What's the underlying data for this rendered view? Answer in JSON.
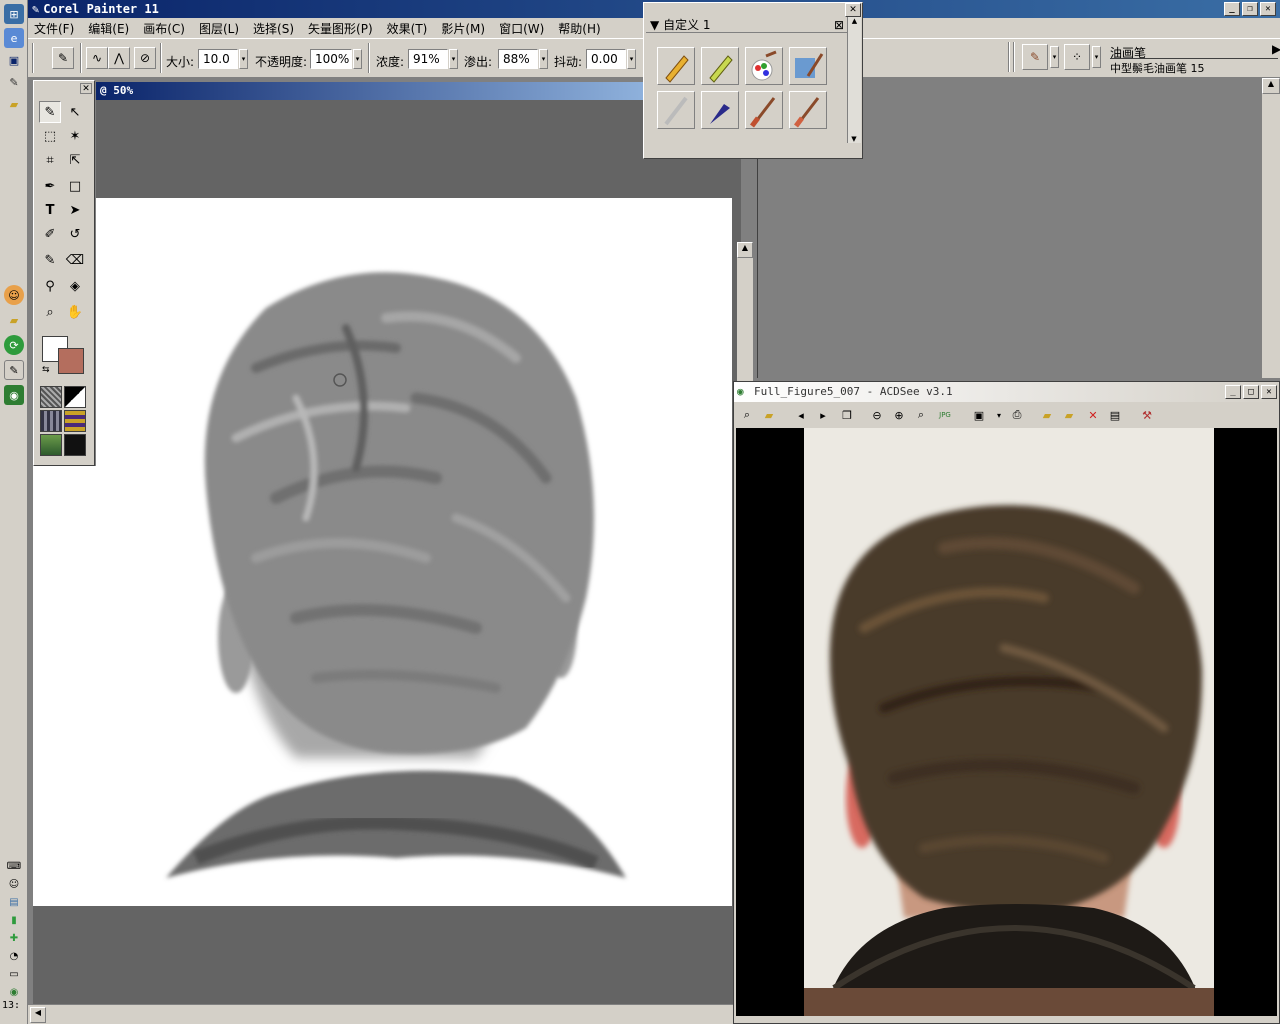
{
  "painter": {
    "title": "Corel Painter 11",
    "menu": [
      "文件(F)",
      "编辑(E)",
      "画布(C)",
      "图层(L)",
      "选择(S)",
      "矢量图形(P)",
      "效果(T)",
      "影片(M)",
      "窗口(W)",
      "帮助(H)"
    ],
    "props": {
      "size_label": "大小:",
      "size_value": "10.0",
      "opacity_label": "不透明度:",
      "opacity_value": "100%",
      "concentration_label": "浓度:",
      "concentration_value": "91%",
      "bleed_label": "渗出:",
      "bleed_value": "88%",
      "jitter_label": "抖动:",
      "jitter_value": "0.00"
    },
    "brush": {
      "category": "油画笔",
      "variant": "中型鬃毛油画笔 15"
    },
    "canvas_title": "@ 50%",
    "colors": {
      "main": "#ffffff",
      "additional": "#b46e5e"
    }
  },
  "palette": {
    "title": "自定义 1"
  },
  "acdsee": {
    "title": "Full_Figure5_007 - ACDSee v3.1"
  },
  "clock": "13:"
}
